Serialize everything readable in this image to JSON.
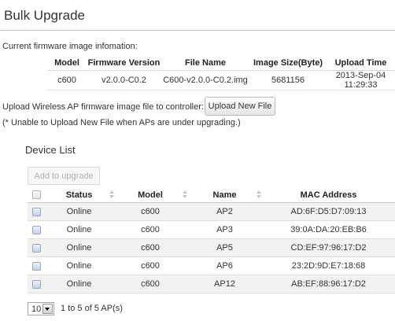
{
  "page": {
    "title": "Bulk Upgrade"
  },
  "firmware": {
    "heading": "Current firmware image infomation:",
    "columns": [
      "Model",
      "Firmware Version",
      "File Name",
      "Image Size(Byte)",
      "Upload Time"
    ],
    "row": {
      "model": "c600",
      "version": "v2.0.0-C0.2",
      "file_name": "C600-v2.0.0-C0.2.img",
      "size": "5681156",
      "upload_time": "2013-Sep-04 11:29:33"
    }
  },
  "upload": {
    "label": "Upload Wireless AP firmware image file to controller:",
    "button_label": "Upload New File",
    "note": "(* Unable to Upload New File when APs are under upgrading.)"
  },
  "device_list": {
    "title": "Device List",
    "add_button_label": "Add to upgrade",
    "add_button_enabled": false,
    "columns": {
      "status": "Status",
      "model": "Model",
      "name": "Name",
      "mac": "MAC Address"
    },
    "rows": [
      {
        "status": "Online",
        "model": "c600",
        "name": "AP2",
        "mac": "AD:6F:D5:D7:09:13"
      },
      {
        "status": "Online",
        "model": "c600",
        "name": "AP3",
        "mac": "39:0A:DA:20:EB:B6"
      },
      {
        "status": "Online",
        "model": "c600",
        "name": "AP5",
        "mac": "CD:EF:97:96:17:D2"
      },
      {
        "status": "Online",
        "model": "c600",
        "name": "AP6",
        "mac": "23:2D:9D:E7:18:68"
      },
      {
        "status": "Online",
        "model": "c600",
        "name": "AP12",
        "mac": "AB:EF:88:96:17:D2"
      }
    ]
  },
  "pager": {
    "page_size": "10",
    "info": "1 to 5 of 5 AP(s)"
  },
  "colors": {
    "alt_row": "#f2f2f2",
    "border": "#dddddd",
    "disabled_text": "#b0b0b0"
  }
}
